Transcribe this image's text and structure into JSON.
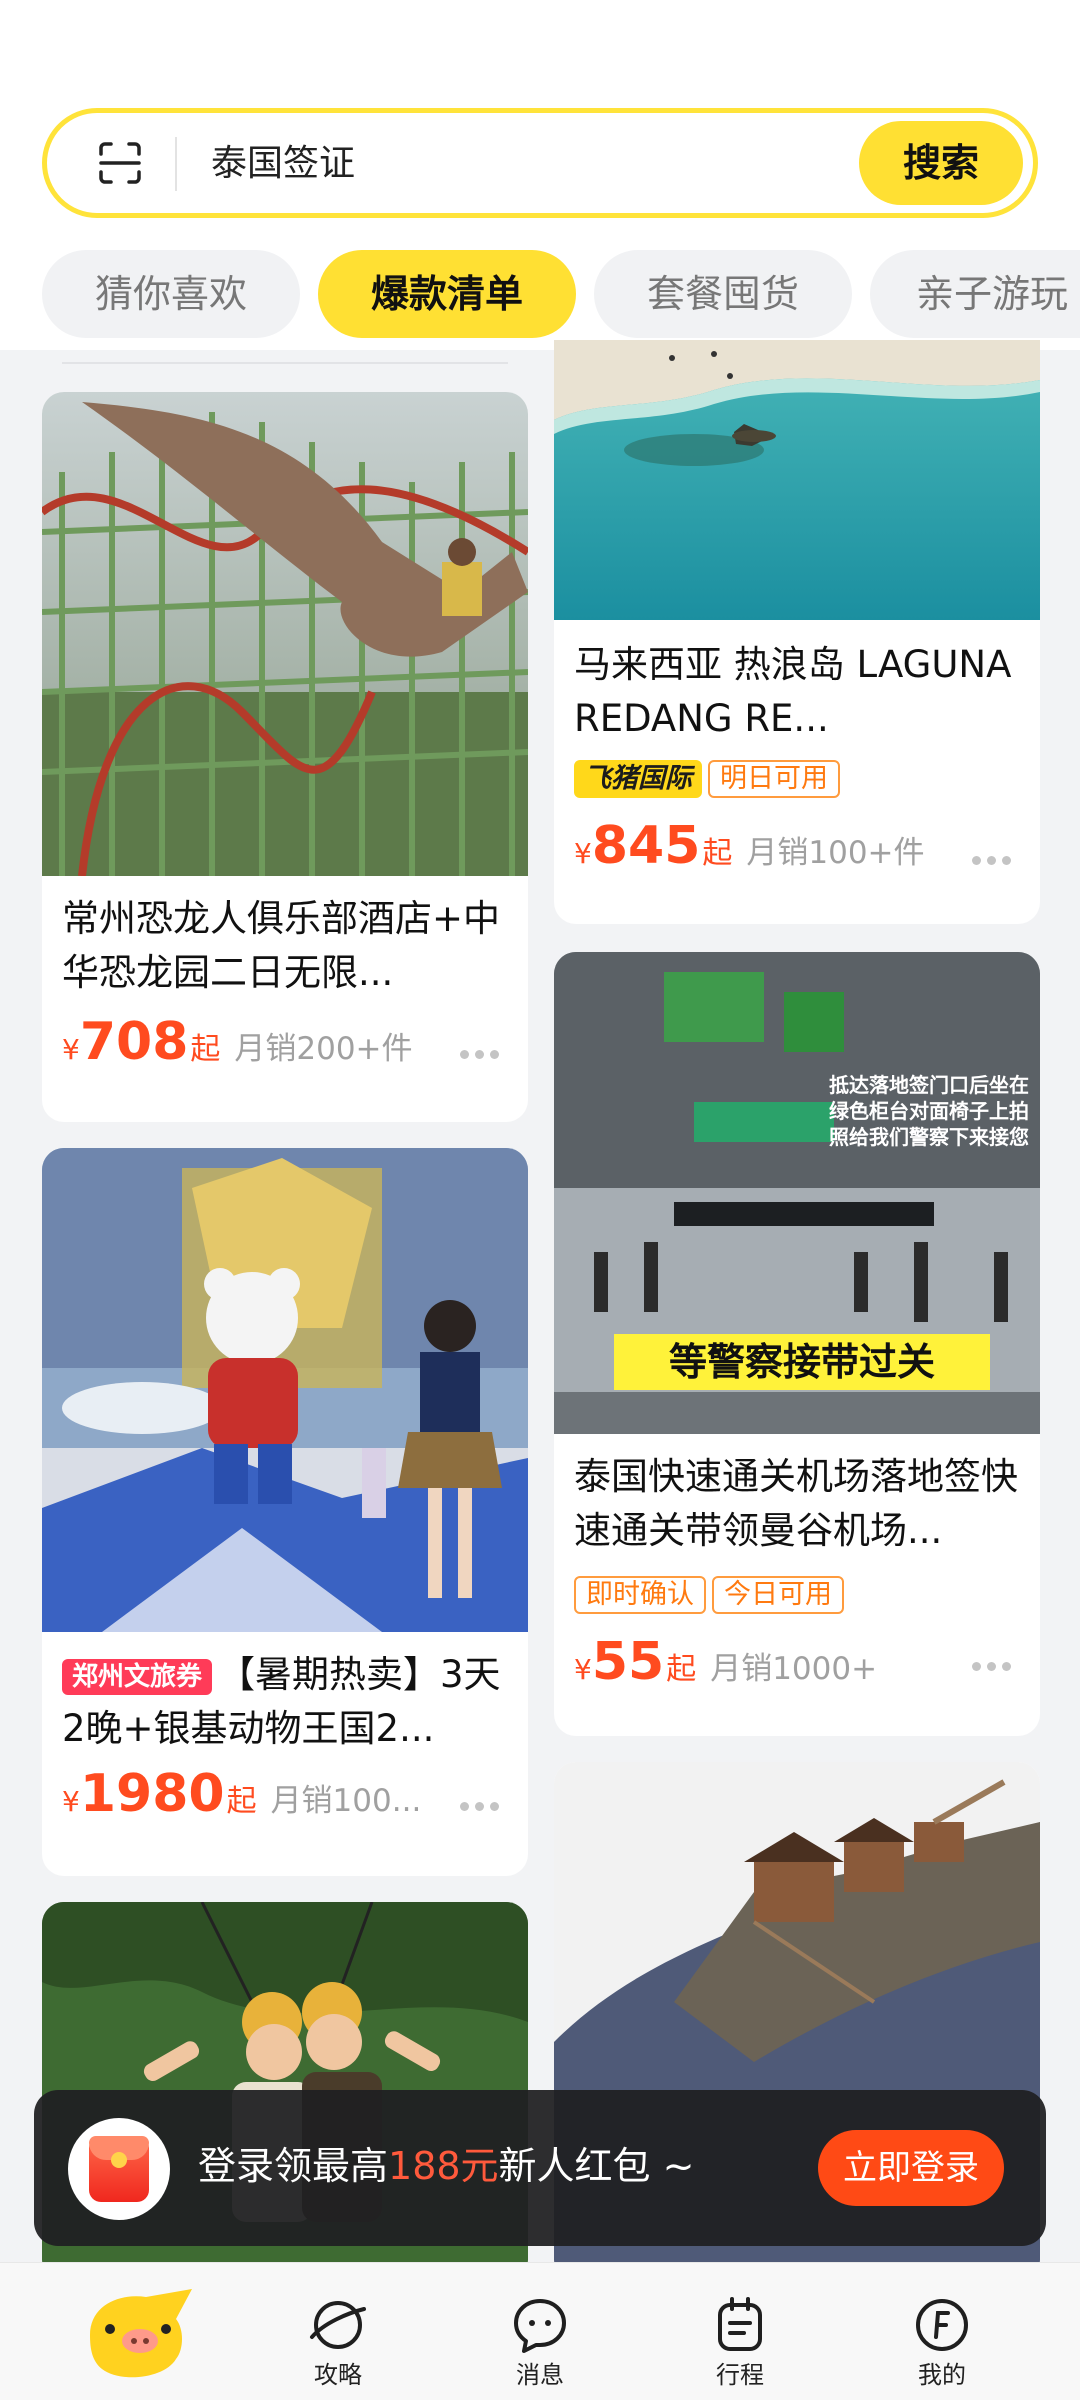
{
  "search": {
    "query": "泰国签证",
    "button_label": "搜索"
  },
  "tabs": [
    {
      "label": "猜你喜欢",
      "active": false
    },
    {
      "label": "爆款清单",
      "active": true
    },
    {
      "label": "套餐囤货",
      "active": false
    },
    {
      "label": "亲子游玩",
      "active": false
    }
  ],
  "cards": {
    "dino": {
      "title": "常州恐龙人俱乐部酒店+中华恐龙园二日无限...",
      "currency": "¥",
      "price": "708",
      "price_suffix": "起",
      "sales": "月销200+件"
    },
    "laguna": {
      "title": "马来西亚 热浪岛 LAGUNA REDANG RE...",
      "badge_brand": "飞猪国际",
      "tag": "明日可用",
      "currency": "¥",
      "price": "845",
      "price_suffix": "起",
      "sales": "月销100+件"
    },
    "bear": {
      "coupon": "郑州文旅券",
      "title": "【暑期热卖】3天2晚+银基动物王国2...",
      "currency": "¥",
      "price": "1980",
      "price_suffix": "起",
      "sales": "月销100..."
    },
    "airport": {
      "image_caption": "等警察接带过关",
      "image_note": "抵达落地签门口后坐在绿色柜台对面椅子上拍照给我们警察下来接您",
      "title": "泰国快速通关机场落地签快速通关带领曼谷机场...",
      "tag1": "即时确认",
      "tag2": "今日可用",
      "currency": "¥",
      "price": "55",
      "price_suffix": "起",
      "sales": "月销1000+"
    }
  },
  "banner": {
    "text_prefix": "登录领最高",
    "text_highlight": "188元",
    "text_suffix": "新人红包 ~",
    "button_label": "立即登录"
  },
  "nav": [
    {
      "label": "攻略",
      "icon": "planet-icon"
    },
    {
      "label": "消息",
      "icon": "chat-bubble-icon"
    },
    {
      "label": "行程",
      "icon": "itinerary-icon"
    },
    {
      "label": "我的",
      "icon": "profile-f-icon"
    }
  ],
  "colors": {
    "accent_yellow": "#ffe033",
    "price_red": "#ff4b1f",
    "login_orange": "#ff4a15"
  }
}
